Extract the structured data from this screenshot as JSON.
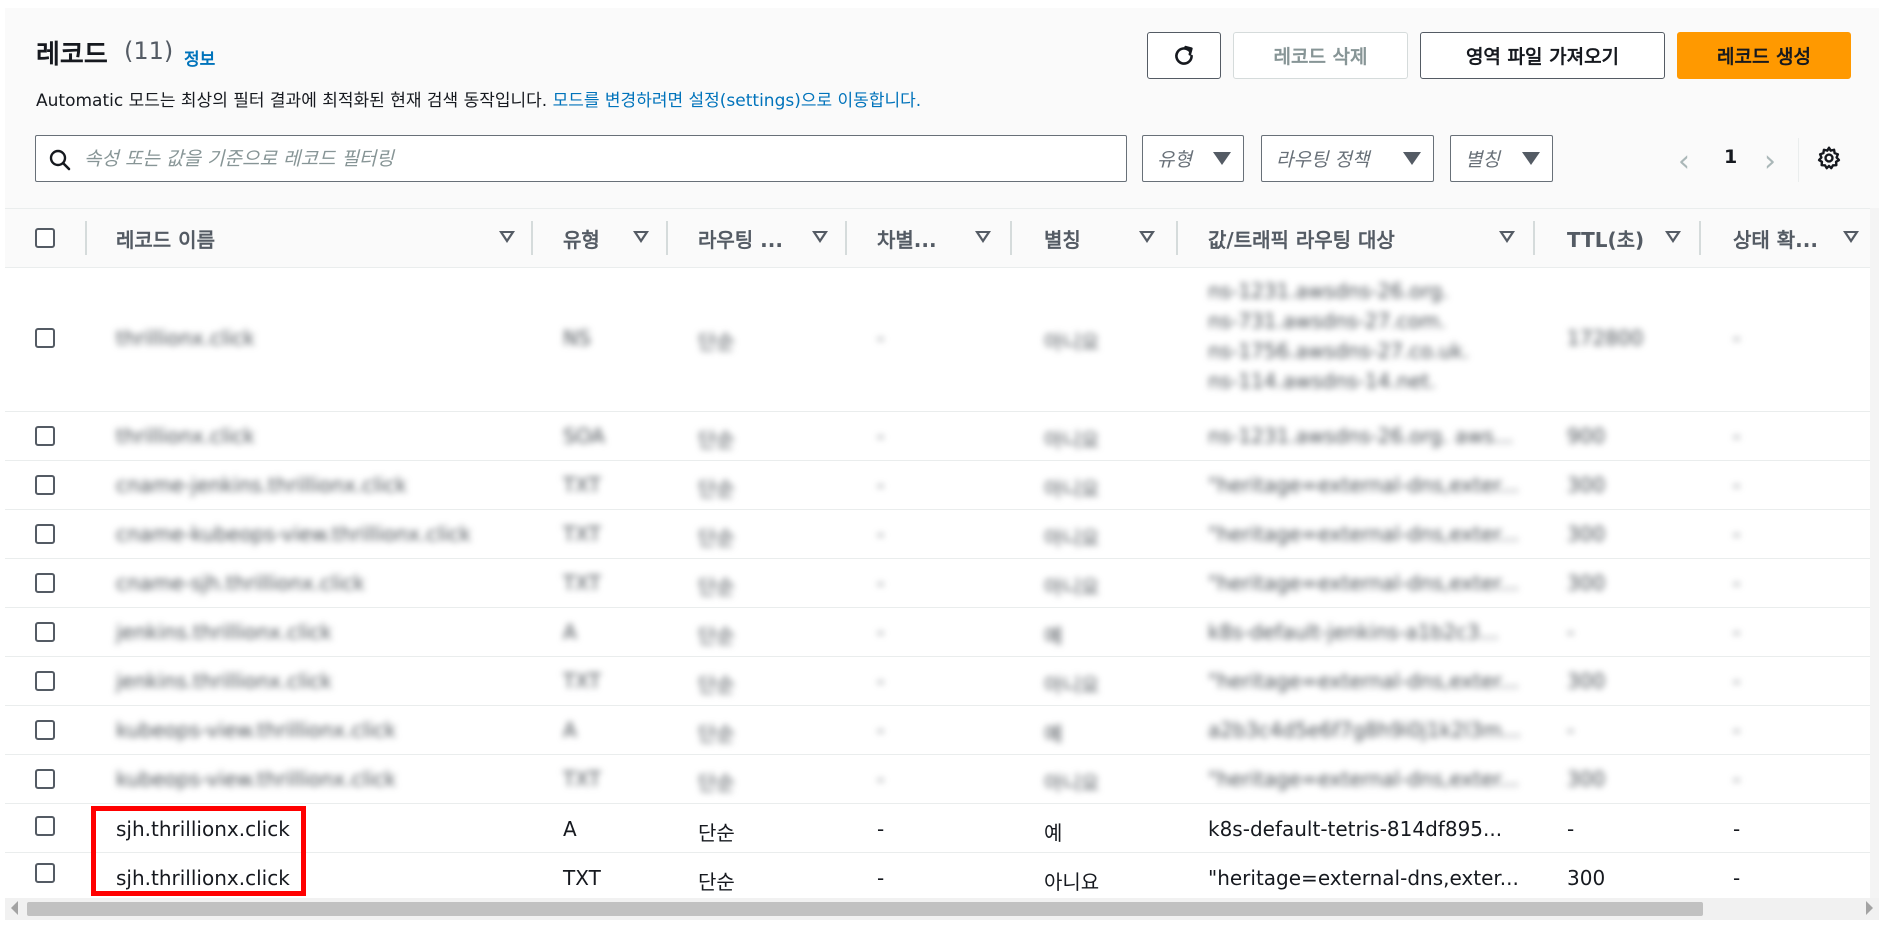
{
  "header": {
    "title": "레코드",
    "count": "(11)",
    "info_link": "정보",
    "description": "Automatic 모드는 최상의 필터 결과에 최적화된 현재 검색 동작입니다.",
    "description_link": "모드를 변경하려면 설정(settings)으로 이동합니다."
  },
  "actions": {
    "delete_label": "레코드 삭제",
    "import_label": "영역 파일 가져오기",
    "create_label": "레코드 생성"
  },
  "search": {
    "placeholder": "속성 또는 값을 기준으로 레코드 필터링"
  },
  "filters": {
    "type": "유형",
    "routing": "라우팅 정책",
    "alias": "별칭"
  },
  "pagination": {
    "page": "1"
  },
  "columns": [
    "레코드 이름",
    "유형",
    "라우팅 ...",
    "차별...",
    "별칭",
    "값/트래픽 라우팅 대상",
    "TTL(초)",
    "상태 확..."
  ],
  "rows": [
    {
      "name": "thrillionx.click",
      "type": "NS",
      "routing": "단순",
      "diff": "-",
      "alias": "아니요",
      "values": [
        "ns-1231.awsdns-26.org.",
        "ns-731.awsdns-27.com.",
        "ns-1756.awsdns-27.co.uk.",
        "ns-114.awsdns-14.net."
      ],
      "ttl": "172800",
      "health": "-"
    },
    {
      "name": "thrillionx.click",
      "type": "SOA",
      "routing": "단순",
      "diff": "-",
      "alias": "아니요",
      "values": [
        "ns-1231.awsdns-26.org. aws..."
      ],
      "ttl": "900",
      "health": "-"
    },
    {
      "name": "cname-jenkins.thrillionx.click",
      "type": "TXT",
      "routing": "단순",
      "diff": "-",
      "alias": "아니요",
      "values": [
        "\"heritage=external-dns,exter..."
      ],
      "ttl": "300",
      "health": "-"
    },
    {
      "name": "cname-kubeops-view.thrillionx.click",
      "type": "TXT",
      "routing": "단순",
      "diff": "-",
      "alias": "아니요",
      "values": [
        "\"heritage=external-dns,exter..."
      ],
      "ttl": "300",
      "health": "-"
    },
    {
      "name": "cname-sjh.thrillionx.click",
      "type": "TXT",
      "routing": "단순",
      "diff": "-",
      "alias": "아니요",
      "values": [
        "\"heritage=external-dns,exter..."
      ],
      "ttl": "300",
      "health": "-"
    },
    {
      "name": "jenkins.thrillionx.click",
      "type": "A",
      "routing": "단순",
      "diff": "-",
      "alias": "예",
      "values": [
        "k8s-default-jenkins-a1b2c3..."
      ],
      "ttl": "-",
      "health": "-"
    },
    {
      "name": "jenkins.thrillionx.click",
      "type": "TXT",
      "routing": "단순",
      "diff": "-",
      "alias": "아니요",
      "values": [
        "\"heritage=external-dns,exter..."
      ],
      "ttl": "300",
      "health": "-"
    },
    {
      "name": "kubeops-view.thrillionx.click",
      "type": "A",
      "routing": "단순",
      "diff": "-",
      "alias": "예",
      "values": [
        "a2b3c4d5e6f7g8h9i0j1k2l3m..."
      ],
      "ttl": "-",
      "health": "-"
    },
    {
      "name": "kubeops-view.thrillionx.click",
      "type": "TXT",
      "routing": "단순",
      "diff": "-",
      "alias": "아니요",
      "values": [
        "\"heritage=external-dns,exter..."
      ],
      "ttl": "300",
      "health": "-"
    },
    {
      "name": "sjh.thrillionx.click",
      "type": "A",
      "routing": "단순",
      "diff": "-",
      "alias": "예",
      "values": [
        "k8s-default-tetris-814df895..."
      ],
      "ttl": "-",
      "health": "-"
    },
    {
      "name": "sjh.thrillionx.click",
      "type": "TXT",
      "routing": "단순",
      "diff": "-",
      "alias": "아니요",
      "values": [
        "\"heritage=external-dns,exter..."
      ],
      "ttl": "300",
      "health": "-"
    }
  ]
}
